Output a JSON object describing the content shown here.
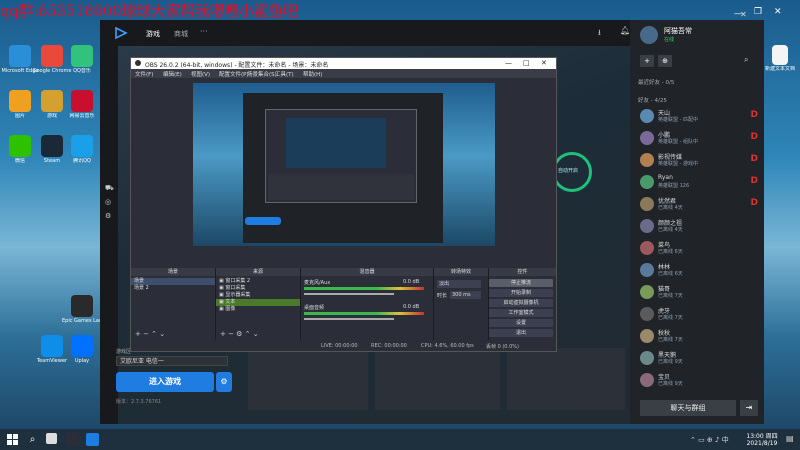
{
  "banner": "qq群:653518600球球大家帮我喂喂小鲨鱼吧",
  "desktop_icons": [
    {
      "label": "Microsoft Edge",
      "color": "#2b8fd8"
    },
    {
      "label": "Google Chrome",
      "color": "#e9483a"
    },
    {
      "label": "QQ音乐",
      "color": "#31c27c"
    },
    {
      "label": "图片",
      "color": "#f0a020"
    },
    {
      "label": "游戏",
      "color": "#d4a030"
    },
    {
      "label": "网易云音乐",
      "color": "#c8102e"
    },
    {
      "label": "微信",
      "color": "#2dc100"
    },
    {
      "label": "Steam",
      "color": "#1b2838"
    },
    {
      "label": "腾讯QQ",
      "color": "#1aa0e8"
    },
    {
      "label": "Epic Games Launcher",
      "color": "#2a2a2a"
    },
    {
      "label": "TeamViewer",
      "color": "#0e8ee9"
    },
    {
      "label": "Uplay",
      "color": "#0070ff"
    }
  ],
  "launcher": {
    "nav": [
      "游戏",
      "商城"
    ],
    "username": "阿猫吾常",
    "status": "在线",
    "sections": {
      "recent": "最近好友 - 0/5",
      "friends": "好友 - 4/25"
    },
    "friends": [
      {
        "name": "天山",
        "status": "英雄联盟 - 匹配中",
        "color": "#5a8ab0",
        "badge": "D"
      },
      {
        "name": "小鹏",
        "status": "英雄联盟 - 组队中",
        "color": "#7a6a9a",
        "badge": "D"
      },
      {
        "name": "影视传媒",
        "status": "英雄联盟 - 游戏中",
        "color": "#b08050",
        "badge": "D"
      },
      {
        "name": "Ryan",
        "status": "英雄联盟 126",
        "color": "#4a9a6a",
        "badge": "D"
      },
      {
        "name": "优然君",
        "status": "已离线 4天",
        "color": "#8a7a5a",
        "badge": "D"
      },
      {
        "name": "颜颜之祖",
        "status": "已离线 4天",
        "color": "#6a6a8a",
        "badge": ""
      },
      {
        "name": "菜鸟",
        "status": "已离线 6天",
        "color": "#9a5a5a",
        "badge": ""
      },
      {
        "name": "林林",
        "status": "已离线 6天",
        "color": "#5a7a9a",
        "badge": ""
      },
      {
        "name": "猫哥",
        "status": "已离线 7天",
        "color": "#7a9a5a",
        "badge": ""
      },
      {
        "name": "虎牙",
        "status": "已离线 7天",
        "color": "#5a5a5a",
        "badge": ""
      },
      {
        "name": "秋秋",
        "status": "已离线 7天",
        "color": "#9a8a6a",
        "badge": ""
      },
      {
        "name": "黑天鹅",
        "status": "已离线 9天",
        "color": "#6a8a8a",
        "badge": ""
      },
      {
        "name": "宝贝",
        "status": "已离线 9天",
        "color": "#8a6a7a",
        "badge": ""
      }
    ],
    "chat_button": "聊天与群组",
    "server_select": "艾欧尼亚 电信一",
    "enter_button": "进入游戏",
    "version": "版本：2.7.3.76761",
    "green_ring_text": "自动开启"
  },
  "obs": {
    "title": "OBS 26.0.2 (64-bit, windows) - 配置文件：未命名 - 场景：未命名",
    "menu": [
      "文件(F)",
      "编辑(E)",
      "视图(V)",
      "配置文件(P)",
      "场景集合(S)",
      "工具(T)",
      "帮助(H)"
    ],
    "docks": [
      "场景",
      "来源",
      "混音器",
      "转场特效",
      "控件"
    ],
    "scenes": [
      "场景",
      "场景 2"
    ],
    "sources": [
      "窗口采集 2",
      "窗口采集",
      "显示器采集",
      "文本",
      "图像"
    ],
    "mixer": [
      {
        "name": "麦克风/Aux",
        "db": "0.0 dB"
      },
      {
        "name": "桌面音频",
        "db": "0.0 dB"
      }
    ],
    "transition": "淡出",
    "duration_label": "时长",
    "duration": "300 ms",
    "controls": [
      "停止推流",
      "开始录制",
      "启动虚拟摄像机",
      "工作室模式",
      "设置",
      "退出"
    ],
    "status": {
      "live": "LIVE: 00:00:00",
      "rec": "REC: 00:00:00",
      "cpu": "CPU: 4.6%, 60.00 fps",
      "drop": "丢帧 0 (0.0%)"
    }
  },
  "taskbar": {
    "time": "13:00 周四",
    "date": "2021/8/19"
  },
  "desktop_right_icon": "新建文本文档"
}
